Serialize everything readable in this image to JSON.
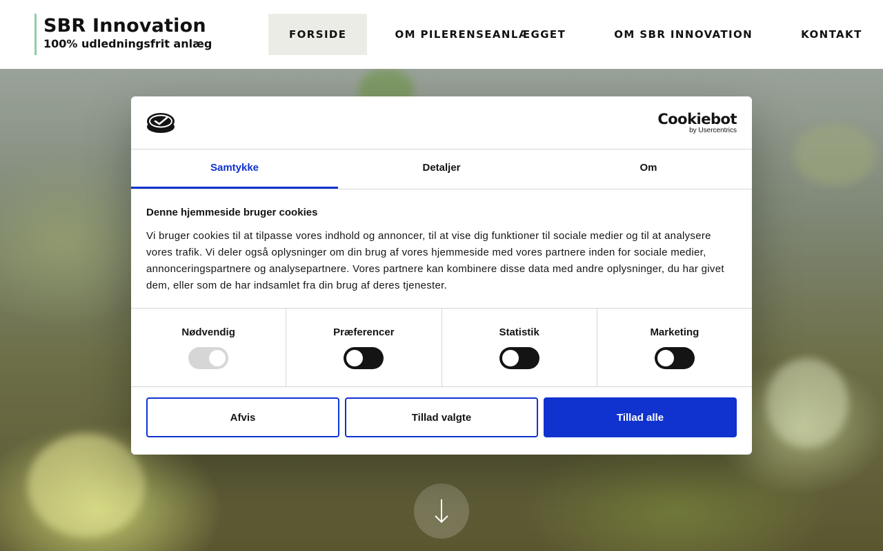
{
  "header": {
    "brand_title": "SBR Innovation",
    "brand_subtitle": "100% udledningsfrit anlæg",
    "nav": [
      {
        "label": "FORSIDE",
        "active": true
      },
      {
        "label": "OM PILERENSEANLÆGGET",
        "active": false
      },
      {
        "label": "OM SBR INNOVATION",
        "active": false
      },
      {
        "label": "KONTAKT",
        "active": false
      }
    ]
  },
  "cookie_dialog": {
    "brand_name": "Cookiebot",
    "brand_by": "by Usercentrics",
    "tabs": [
      {
        "label": "Samtykke",
        "active": true
      },
      {
        "label": "Detaljer",
        "active": false
      },
      {
        "label": "Om",
        "active": false
      }
    ],
    "heading": "Denne hjemmeside bruger cookies",
    "text": "Vi bruger cookies til at tilpasse vores indhold og annoncer, til at vise dig funktioner til sociale medier og til at analysere vores trafik. Vi deler også oplysninger om din brug af vores hjemmeside med vores partnere inden for sociale medier, annonceringspartnere og analysepartnere. Vores partnere kan kombinere disse data med andre oplysninger, du har givet dem, eller som de har indsamlet fra din brug af deres tjenester.",
    "toggles": [
      {
        "label": "Nødvendig",
        "state": "disabled-on"
      },
      {
        "label": "Præferencer",
        "state": "off"
      },
      {
        "label": "Statistik",
        "state": "off"
      },
      {
        "label": "Marketing",
        "state": "off"
      }
    ],
    "buttons": {
      "reject": "Afvis",
      "allow_selected": "Tillad valgte",
      "allow_all": "Tillad alle"
    }
  },
  "colors": {
    "accent": "#1032cf",
    "brand_border": "#8fcfa0",
    "nav_active_bg": "#ebece6",
    "toggle_dark": "#141414"
  },
  "icons": {
    "scroll": "arrow-down-icon",
    "cookiebot": "cookiebot-logo-icon"
  }
}
